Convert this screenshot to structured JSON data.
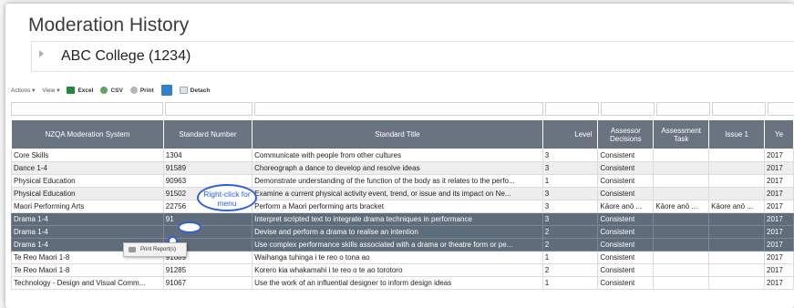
{
  "title": "Moderation History",
  "college": "ABC College (1234)",
  "toolbar": {
    "actions": "Actions",
    "view": "View",
    "excel": "Excel",
    "csv": "CSV",
    "print": "Print",
    "detach": "Detach",
    "excel_icon": "excel-icon",
    "csv_icon": "csv-icon",
    "print_icon": "printer-icon",
    "detach_icon": "detach-icon"
  },
  "columns": [
    "NZQA Moderation System",
    "Standard Number",
    "Standard Title",
    "Level",
    "Assessor Decisions",
    "Assessment Task",
    "Issue 1",
    "Ye"
  ],
  "rows": [
    [
      "Core Skills",
      "1304",
      "Communicate with people from other cultures",
      "3",
      "Consistent",
      "",
      "",
      "2017"
    ],
    [
      "Dance 1-4",
      "91589",
      "Choreograph a dance to develop and resolve ideas",
      "3",
      "Consistent",
      "",
      "",
      "2017"
    ],
    [
      "Physical Education",
      "90963",
      "Demonstrate understanding of the function of the body as it relates to the perfo...",
      "1",
      "Consistent",
      "",
      "",
      "2017"
    ],
    [
      "Physical Education",
      "91502",
      "Examine a current physical activity event, trend, or issue and its impact on Ne...",
      "3",
      "Consistent",
      "",
      "",
      "2017"
    ],
    [
      "Maori Performing Arts",
      "22756",
      "Perform a Maori performing arts bracket",
      "3",
      "Kāore anō ...",
      "Kāore anō ...",
      "Kāore anō ...",
      "2017"
    ],
    [
      "Drama 1-4",
      "91",
      "Interpret scripted text to integrate drama techniques in performance",
      "3",
      "Consistent",
      "",
      "",
      "2017"
    ],
    [
      "Drama 1-4",
      "",
      "Devise and perform a drama to realise an intention",
      "2",
      "Consistent",
      "",
      "",
      "2017"
    ],
    [
      "Drama 1-4",
      "",
      "Use complex performance skills associated with a drama or theatre form or pe...",
      "2",
      "Consistent",
      "",
      "",
      "2017"
    ],
    [
      "Te Reo Maori 1-8",
      "91089",
      "Waihanga tuhinga i te reo o tona ao",
      "1",
      "Consistent",
      "",
      "",
      "2017"
    ],
    [
      "Te Reo Maori 1-8",
      "91285",
      "Korero kia whakamahi i te reo o te ao torotoro",
      "2",
      "Consistent",
      "",
      "",
      "2017"
    ],
    [
      "Technology - Design and Visual Comm...",
      "91067",
      "Use the work of an influential designer to inform design ideas",
      "1",
      "Consistent",
      "",
      "",
      "2017"
    ]
  ],
  "selected_rows": [
    5,
    6,
    7
  ],
  "alt_rows": [
    1,
    3
  ],
  "callout": "Right-click for menu",
  "context_menu": {
    "label": "Print Report(s)",
    "icon": "printer-icon"
  }
}
